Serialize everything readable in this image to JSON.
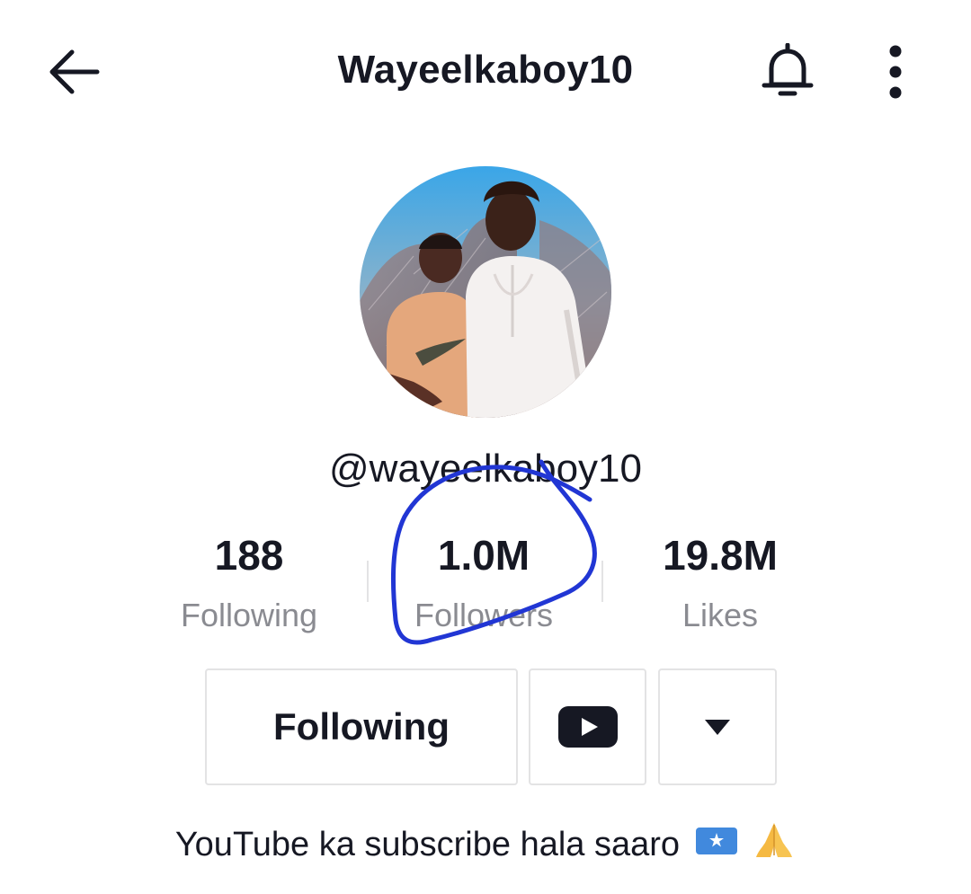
{
  "header": {
    "title": "Wayeelkaboy10",
    "back_icon": "arrow-left-icon",
    "bell_icon": "bell-icon",
    "more_icon": "more-vertical-icon"
  },
  "profile": {
    "handle": "@wayeelkaboy10",
    "avatar_alt": "profile-avatar"
  },
  "stats": {
    "following": {
      "value": "188",
      "label": "Following"
    },
    "followers": {
      "value": "1.0M",
      "label": "Followers"
    },
    "likes": {
      "value": "19.8M",
      "label": "Likes"
    }
  },
  "actions": {
    "following_label": "Following",
    "youtube_icon": "youtube-icon",
    "dropdown_icon": "caret-down-icon"
  },
  "bio": {
    "text": "YouTube ka subscribe hala saaro",
    "emoji": [
      "somalia-flag-emoji",
      "folded-hands-emoji"
    ]
  },
  "colors": {
    "text": "#161823",
    "muted": "#8a8b91",
    "border": "#e3e3e4",
    "annotation": "#2136d4",
    "flag_blue": "#4189dd"
  }
}
